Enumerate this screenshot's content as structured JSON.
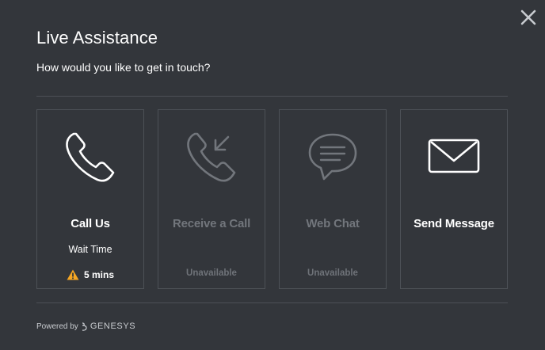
{
  "dialog": {
    "title": "Live Assistance",
    "subtitle": "How would you like to get in touch?"
  },
  "options": [
    {
      "label": "Call Us",
      "icon": "phone-icon",
      "wait_label": "Wait Time",
      "wait_time": "5 mins",
      "status_icon": "warning-icon",
      "status_color": "#f5a623"
    },
    {
      "label": "Receive a Call",
      "icon": "phone-incoming-icon",
      "status": "Unavailable"
    },
    {
      "label": "Web Chat",
      "icon": "chat-bubble-icon",
      "status": "Unavailable"
    },
    {
      "label": "Send Message",
      "icon": "envelope-icon"
    }
  ],
  "footer": {
    "powered_by": "Powered by",
    "brand": "GENESYS"
  },
  "colors": {
    "background": "#33363b",
    "border": "#4d5157",
    "disabled_text": "#72767c",
    "warning": "#f5a623"
  }
}
